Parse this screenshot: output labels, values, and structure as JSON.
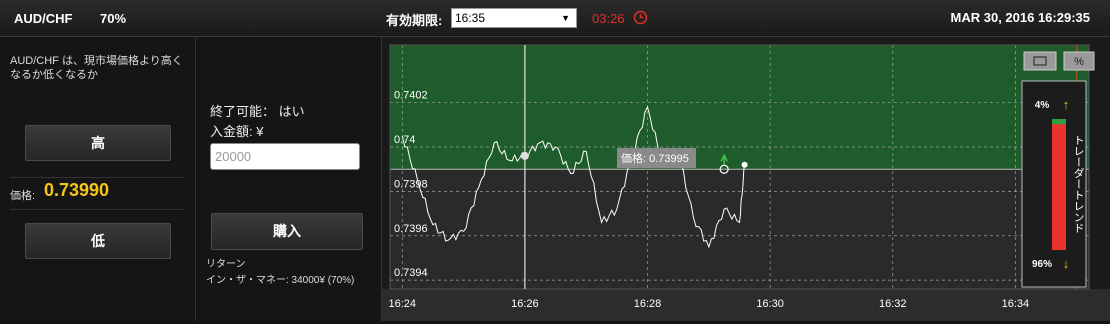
{
  "header": {
    "asset": "AUD/CHF",
    "payout": "70%",
    "expiry_label": "有効期限:",
    "expiry_value": "16:35",
    "countdown": "03:26",
    "datetime": "MAR 30, 2016 16:29:35"
  },
  "left_panel": {
    "description": "AUD/CHF は、現市場価格より高くなるか低くなるか",
    "high_label": "高",
    "price_label": "価格:",
    "price_value": "0.73990",
    "low_label": "低"
  },
  "middle_panel": {
    "can_close": "終了可能： はい",
    "amount_label": "入金額: ¥",
    "amount_placeholder": "20000",
    "buy_label": "購入",
    "return_label": "リターン",
    "return_value": "イン・ザ・マネー: 34000¥ (70%)"
  },
  "colors": {
    "up_zone": "#1f5c2b",
    "down_zone": "#2a2a2a",
    "price_accent": "#f5c518",
    "countdown": "#e0302a",
    "expiry_line": "#c0571f"
  },
  "chart_data": {
    "type": "line",
    "y_ticks": [
      "0.7402",
      "0.74",
      "0.7398",
      "0.7396",
      "0.7394"
    ],
    "x_ticks": [
      "16:24",
      "16:26",
      "16:28",
      "16:30",
      "16:32",
      "16:34"
    ],
    "tooltip": "価格: 0.73995",
    "expiry_time": "16:35",
    "current_price": 0.7399,
    "series": [
      {
        "x": [
          "16:24:00",
          "16:24:15",
          "16:24:30",
          "16:24:45",
          "16:25:00",
          "16:25:15",
          "16:25:30",
          "16:25:45",
          "16:26:00",
          "16:26:15",
          "16:26:30",
          "16:26:45",
          "16:27:00",
          "16:27:15",
          "16:27:30",
          "16:27:45",
          "16:28:00",
          "16:28:15",
          "16:28:30",
          "16:28:45",
          "16:29:00",
          "16:29:15",
          "16:29:30",
          "16:29:35"
        ],
        "y": [
          0.74005,
          0.73985,
          0.73965,
          0.73958,
          0.73962,
          0.73982,
          0.74002,
          0.73994,
          0.73996,
          0.74002,
          0.74,
          0.73988,
          0.73998,
          0.73966,
          0.73972,
          0.73996,
          0.74018,
          0.73992,
          0.73998,
          0.73968,
          0.73955,
          0.73972,
          0.73966,
          0.73992
        ]
      }
    ],
    "trend": {
      "title": "トレーダートレンド",
      "up_percent": "4%",
      "down_percent": "96%",
      "up_fraction": 0.04
    }
  }
}
